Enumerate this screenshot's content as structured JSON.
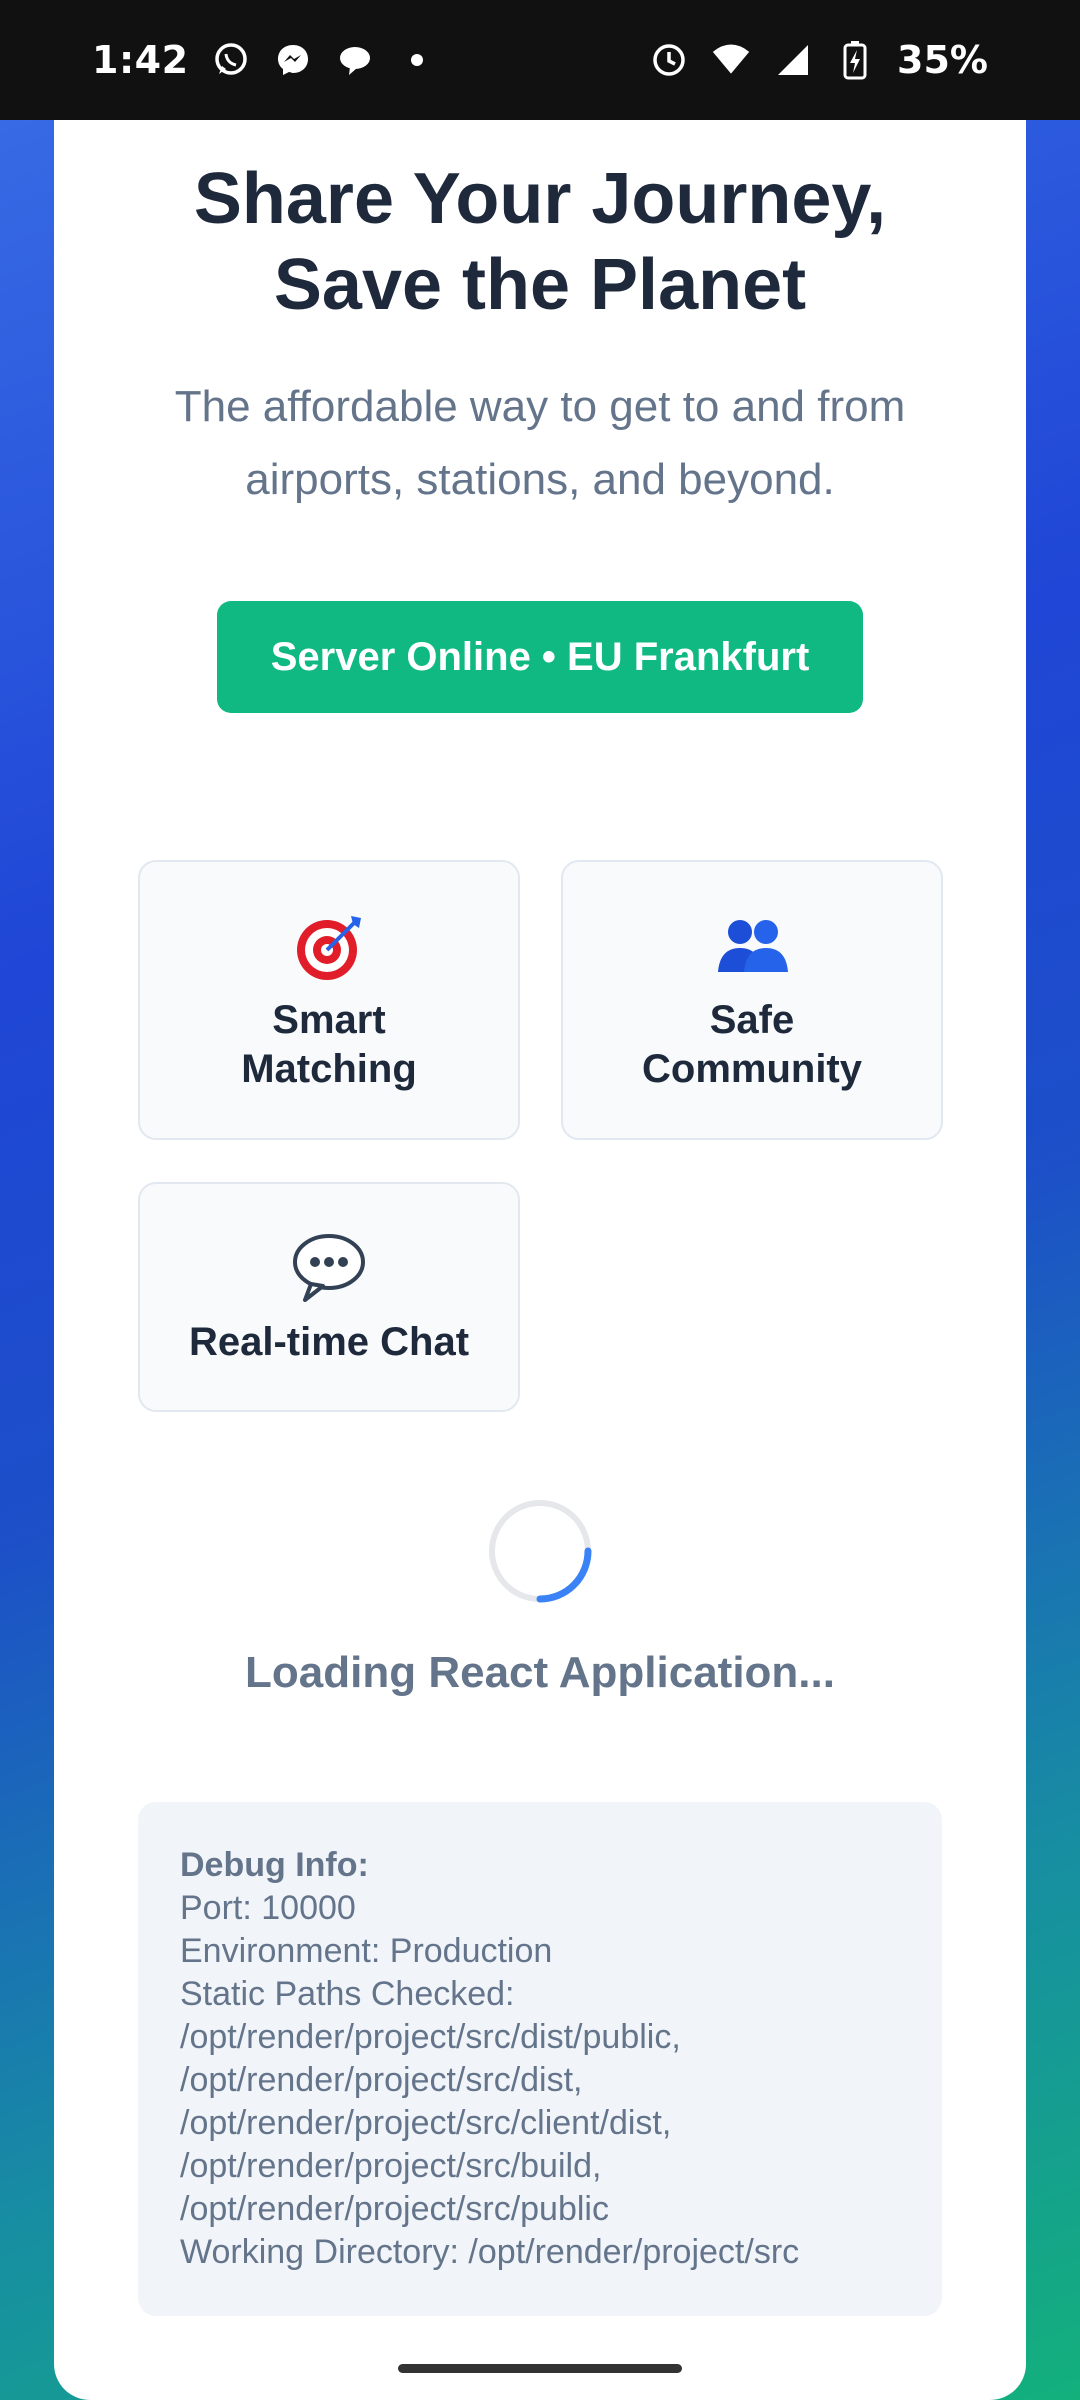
{
  "status_bar": {
    "time": "1:42",
    "battery": "35%",
    "icons": [
      "whatsapp-icon",
      "messenger-icon",
      "chat-bubble-icon",
      "notification-dot-icon",
      "alarm-icon",
      "wifi-icon",
      "cellular-signal-icon",
      "battery-charging-icon"
    ]
  },
  "hero": {
    "title": "Share Your Journey,\nSave the Planet",
    "subtitle": "The affordable way to get to and from airports, stations, and beyond."
  },
  "server_status": {
    "label": "Server Online • EU Frankfurt",
    "color": "#10b981"
  },
  "features": [
    {
      "icon": "target-icon",
      "label": "Smart\nMatching"
    },
    {
      "icon": "people-icon",
      "label": "Safe\nCommunity"
    },
    {
      "icon": "speech-bubble-icon",
      "label": "Real-time Chat"
    }
  ],
  "loading": {
    "text": "Loading React Application..."
  },
  "debug": {
    "title": "Debug Info:",
    "lines": [
      "Port: 10000",
      "Environment: Production",
      "Static Paths Checked:",
      "/opt/render/project/src/dist/public,",
      "/opt/render/project/src/dist,",
      "/opt/render/project/src/client/dist,",
      "/opt/render/project/src/build,",
      "/opt/render/project/src/public",
      "Working Directory: /opt/render/project/src"
    ]
  },
  "colors": {
    "accent": "#10b981",
    "spinner": "#3b82f6",
    "heading": "#1e293b",
    "muted": "#64748b"
  }
}
